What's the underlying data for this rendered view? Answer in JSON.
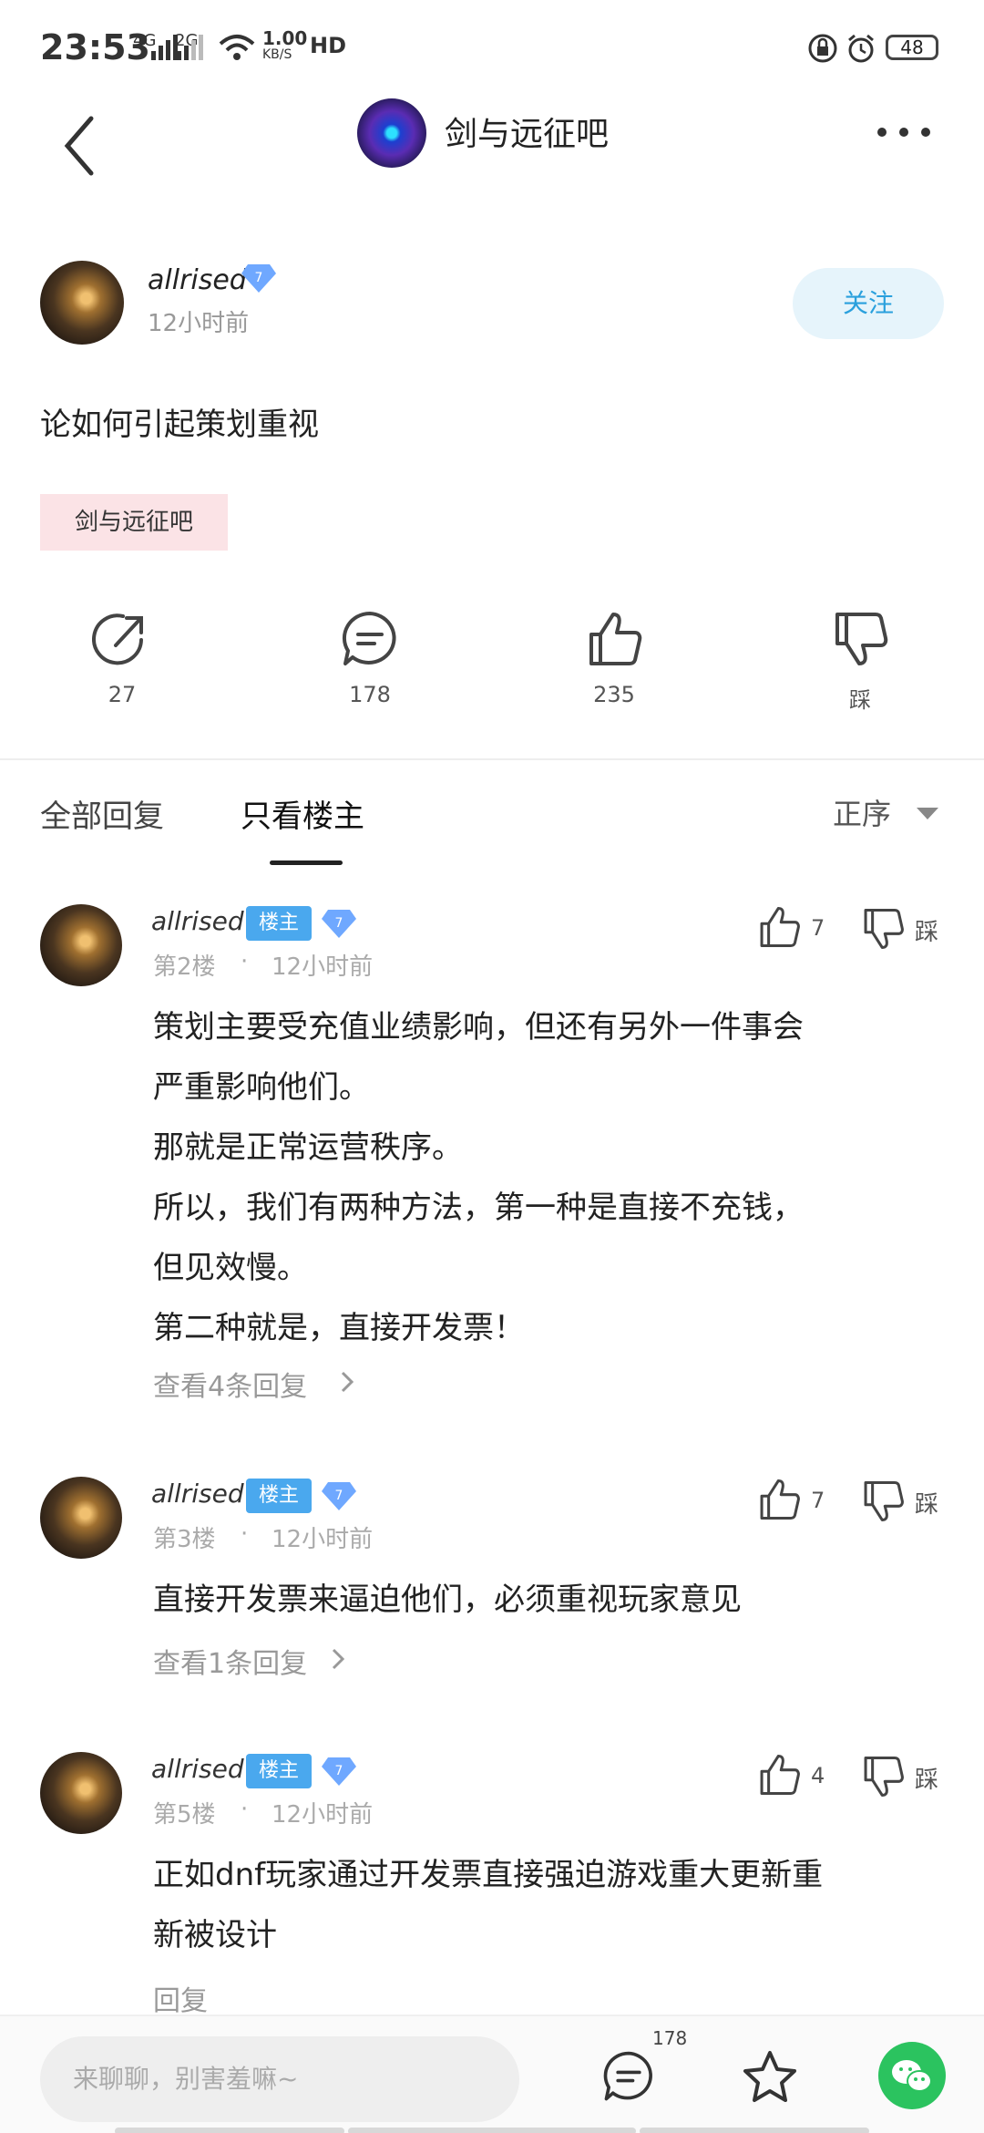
{
  "status": {
    "time": "23:53",
    "network1": "4G",
    "network2": "2G",
    "speed": "1.00",
    "speed_unit": "KB/S",
    "hd": "HD",
    "battery": "48"
  },
  "header": {
    "forum_name": "剑与远征吧"
  },
  "post": {
    "author": "allrised",
    "level": "7",
    "time": "12小时前",
    "follow_label": "关注",
    "title": "论如何引起策划重视",
    "tag": "剑与远征吧",
    "actions": {
      "share_count": "27",
      "comment_count": "178",
      "like_count": "235",
      "dislike_label": "踩"
    }
  },
  "tabs": {
    "all": "全部回复",
    "host_only": "只看楼主",
    "sort": "正序"
  },
  "replies": [
    {
      "author": "allrised",
      "badge": "楼主",
      "level": "7",
      "floor": "第2楼",
      "dot": "·",
      "time": "12小时前",
      "likes": "7",
      "dislike": "踩",
      "lines": [
        "策划主要受充值业绩影响，但还有另外一件事会",
        "严重影响他们。",
        "那就是正常运营秩序。",
        "所以，我们有两种方法，第一种是直接不充钱，",
        "但见效慢。",
        "第二种就是，直接开发票！"
      ],
      "view_replies": "查看4条回复"
    },
    {
      "author": "allrised",
      "badge": "楼主",
      "level": "7",
      "floor": "第3楼",
      "dot": "·",
      "time": "12小时前",
      "likes": "7",
      "dislike": "踩",
      "lines": [
        "直接开发票来逼迫他们，必须重视玩家意见"
      ],
      "view_replies": "查看1条回复"
    },
    {
      "author": "allrised",
      "badge": "楼主",
      "level": "7",
      "floor": "第5楼",
      "dot": "·",
      "time": "12小时前",
      "likes": "4",
      "dislike": "踩",
      "lines": [
        "正如dnf玩家通过开发票直接强迫游戏重大更新重",
        "新被设计"
      ],
      "view_replies": "回复"
    }
  ],
  "bottom": {
    "placeholder": "来聊聊，别害羞嘛~",
    "comment_count": "178"
  }
}
